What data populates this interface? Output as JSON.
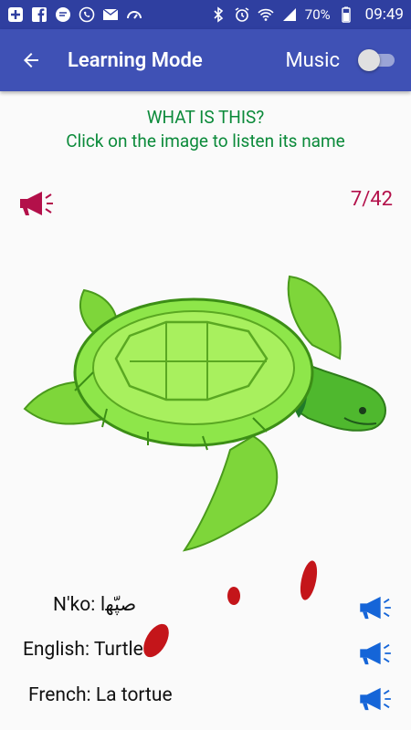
{
  "status_bar": {
    "battery": "70%",
    "time": "09:49"
  },
  "app_bar": {
    "title": "Learning Mode",
    "music_label": "Music",
    "music_on": false
  },
  "prompt": {
    "line1": "WHAT IS THIS?",
    "line2": "Click on the image to listen its name"
  },
  "counter": "7/42",
  "languages": [
    {
      "label": "N'ko: ﺻﭙّﮭﺍ"
    },
    {
      "label": "English: Turtle"
    },
    {
      "label": "French: La tortue"
    }
  ],
  "colors": {
    "status_bar": "#2f3fa0",
    "app_bar": "#3f51b5",
    "prompt": "#0b8a3a",
    "counter": "#b3104a",
    "speaker_blue": "#1565d8",
    "speaker_red": "#b3104a"
  }
}
